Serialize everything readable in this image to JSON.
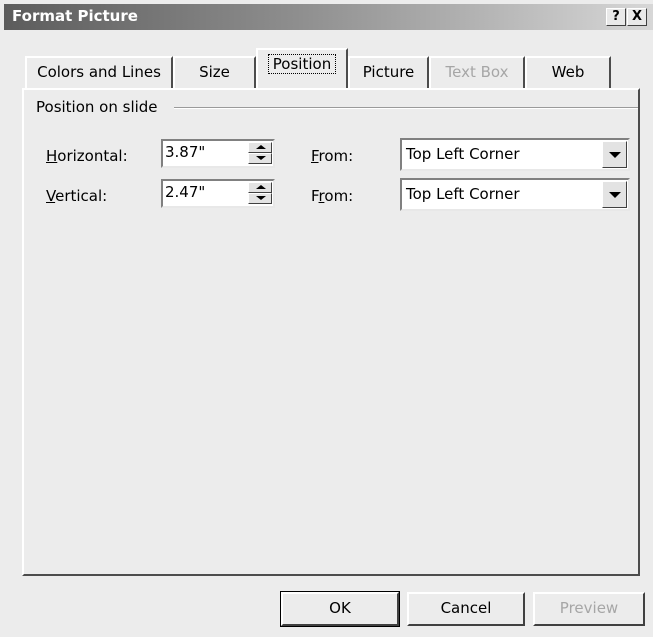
{
  "window": {
    "title": "Format Picture",
    "help_button": "?",
    "close_button": "X"
  },
  "tabs": [
    {
      "label": "Colors and Lines",
      "state": "normal"
    },
    {
      "label": "Size",
      "state": "normal"
    },
    {
      "label": "Position",
      "state": "active"
    },
    {
      "label": "Picture",
      "state": "normal"
    },
    {
      "label": "Text Box",
      "state": "disabled"
    },
    {
      "label": "Web",
      "state": "normal"
    }
  ],
  "position_group": {
    "title": "Position on slide",
    "horizontal": {
      "label_mnemonic": "H",
      "label_rest": "orizontal:",
      "value": "3.87\"",
      "from_label_mnemonic": "F",
      "from_label_rest": "rom:",
      "from_value": "Top Left Corner"
    },
    "vertical": {
      "label_mnemonic": "V",
      "label_rest": "ertical:",
      "value": "2.47\"",
      "from_label_prefix": "F",
      "from_label_mnemonic": "r",
      "from_label_rest": "om:",
      "from_value": "Top Left Corner"
    }
  },
  "buttons": {
    "ok": "OK",
    "cancel": "Cancel",
    "preview": "Preview"
  }
}
